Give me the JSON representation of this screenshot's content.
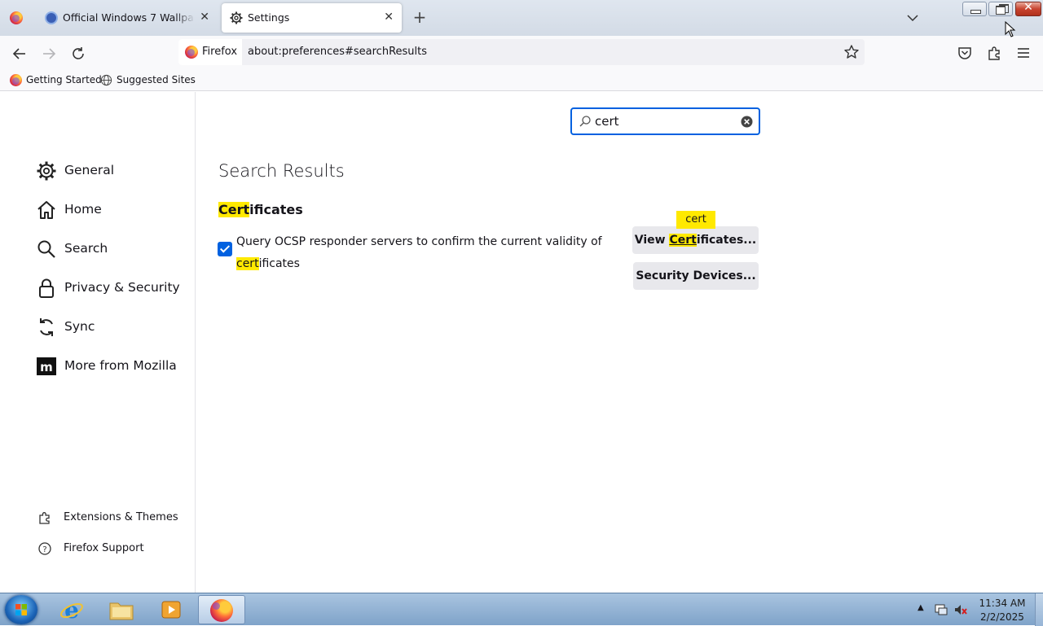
{
  "browser": {
    "tabs": [
      {
        "label": "Official Windows 7 Wallpapers"
      },
      {
        "label": "Settings",
        "active": true
      }
    ],
    "nav": {
      "identity_label": "Firefox",
      "url": "about:preferences#searchResults"
    },
    "bookmarks": [
      {
        "label": "Getting Started",
        "icon": "firefox-icon"
      },
      {
        "label": "Suggested Sites",
        "icon": "globe-icon"
      }
    ]
  },
  "sidebar": {
    "categories": [
      {
        "label": "General",
        "icon": "gear-icon"
      },
      {
        "label": "Home",
        "icon": "home-icon"
      },
      {
        "label": "Search",
        "icon": "search-icon"
      },
      {
        "label": "Privacy & Security",
        "icon": "lock-icon"
      },
      {
        "label": "Sync",
        "icon": "sync-icon"
      },
      {
        "label": "More from Mozilla",
        "icon": "mozilla-icon"
      }
    ],
    "footer": [
      {
        "label": "Extensions & Themes",
        "icon": "puzzle-icon"
      },
      {
        "label": "Firefox Support",
        "icon": "help-icon"
      }
    ]
  },
  "main": {
    "search_value": "cert",
    "results_title": "Search Results",
    "certificates": {
      "heading_hl": "Cert",
      "heading_rest": "ificates",
      "ocsp_text": "Query OCSP responder servers to confirm the current validity of",
      "ocsp_hl": "cert",
      "ocsp_rest": "ificates",
      "ocsp_checked": true,
      "view_pre": "View ",
      "view_hl": "Cert",
      "view_rest": "ificates...",
      "security_devices": "Security Devices...",
      "tooltip": "cert"
    },
    "highlight_color": "#ffe900",
    "accent_color": "#0061e0"
  },
  "taskbar": {
    "clock_time": "11:34 AM",
    "clock_date": "2/2/2025"
  }
}
